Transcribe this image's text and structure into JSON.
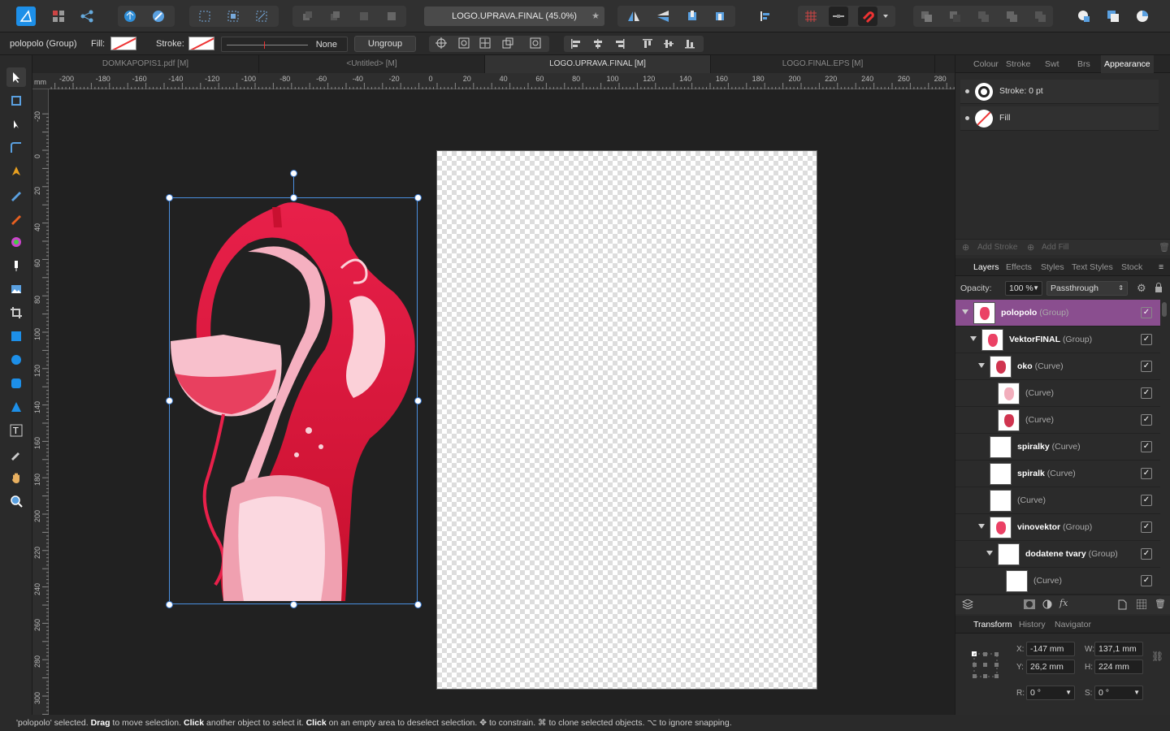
{
  "toolbar": {
    "document_title": "LOGO.UPRAVA.FINAL (45.0%)",
    "star": "★",
    "accent": "#1d8fe8"
  },
  "context_bar": {
    "selection_label": "polopolo (Group)",
    "fill_label": "Fill:",
    "stroke_label": "Stroke:",
    "stroke_style": "None",
    "ungroup_label": "Ungroup"
  },
  "doc_tabs": [
    {
      "label": "DOMKAPOPIS1.pdf [M]"
    },
    {
      "label": "<Untitled> [M]"
    },
    {
      "label": "LOGO.UPRAVA.FINAL [M]"
    },
    {
      "label": "LOGO.FINAL.EPS [M]"
    }
  ],
  "ruler": {
    "unit": "mm",
    "top_labels": [
      "-200",
      "-180",
      "-160",
      "-140",
      "-120",
      "-100",
      "-80",
      "-60",
      "-40",
      "-20",
      "0",
      "20",
      "40",
      "60",
      "80",
      "100",
      "120",
      "140",
      "160",
      "180",
      "200",
      "220",
      "240",
      "260",
      "280"
    ],
    "left_labels": [
      "-20",
      "0",
      "20",
      "40",
      "60",
      "80",
      "100",
      "120",
      "140",
      "160",
      "180",
      "200",
      "220",
      "240",
      "260",
      "280",
      "300"
    ]
  },
  "appearance_panel": {
    "tabs": [
      "Colour",
      "Stroke",
      "Swt",
      "Brs",
      "Appearance"
    ],
    "stroke_row": "Stroke: 0 pt",
    "fill_row": "Fill",
    "add_stroke": "Add Stroke",
    "add_fill": "Add Fill"
  },
  "layers_panel": {
    "tabs": [
      "Layers",
      "Effects",
      "Styles",
      "Text Styles",
      "Stock"
    ],
    "opacity_label": "Opacity:",
    "opacity_value": "100 %",
    "blend_mode": "Passthrough",
    "items": [
      {
        "name": "polopolo",
        "type": "(Group)"
      },
      {
        "name": "VektorFINAL",
        "type": "(Group)"
      },
      {
        "name": "oko",
        "type": "(Curve)"
      },
      {
        "name": "",
        "type": "(Curve)"
      },
      {
        "name": "",
        "type": "(Curve)"
      },
      {
        "name": "spiralky",
        "type": "(Curve)"
      },
      {
        "name": "spiralk",
        "type": "(Curve)"
      },
      {
        "name": "",
        "type": "(Curve)"
      },
      {
        "name": "vinovektor",
        "type": "(Group)"
      },
      {
        "name": "dodatene tvary",
        "type": "(Group)"
      },
      {
        "name": "",
        "type": "(Curve)"
      }
    ]
  },
  "transform_panel": {
    "tabs": [
      "Transform",
      "History",
      "Navigator"
    ],
    "x_label": "X:",
    "x": "-147 mm",
    "y_label": "Y:",
    "y": "26,2 mm",
    "w_label": "W:",
    "w": "137,1 mm",
    "h_label": "H:",
    "h": "224 mm",
    "r_label": "R:",
    "r": "0 °",
    "s_label": "S:",
    "s": "0 °"
  },
  "status": {
    "p1": "'polopolo' selected. ",
    "b1": "Drag",
    "p2": " to move selection. ",
    "b2": "Click",
    "p3": " another object to select it. ",
    "b3": "Click",
    "p4": " on an empty area to deselect selection. ✥ to constrain. ⌘ to clone selected objects. ⌥ to ignore snapping."
  }
}
